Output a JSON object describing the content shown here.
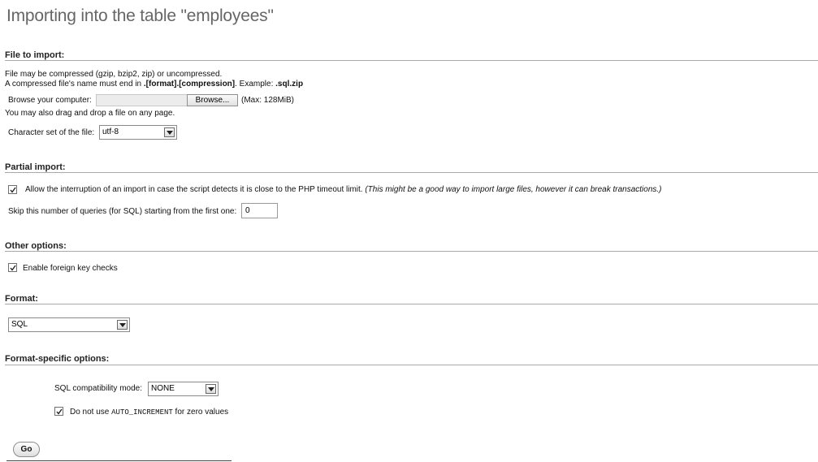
{
  "page": {
    "title": "Importing into the table \"employees\""
  },
  "file_section": {
    "title": "File to import:",
    "desc_line1": "File may be compressed (gzip, bzip2, zip) or uncompressed.",
    "desc_line2_prefix": "A compressed file's name must end in ",
    "desc_line2_format": ".[format].[compression]",
    "desc_line2_mid": ". Example: ",
    "desc_line2_example": ".sql.zip",
    "browse_label": "Browse your computer:",
    "browse_button": "Browse...",
    "max_size": "(Max: 128MiB)",
    "drag_drop_note": "You may also drag and drop a file on any page.",
    "charset_label": "Character set of the file:",
    "charset_value": "utf-8"
  },
  "partial_section": {
    "title": "Partial import:",
    "allow_interrupt_checked": true,
    "allow_interrupt_label": "Allow the interruption of an import in case the script detects it is close to the PHP timeout limit.",
    "allow_interrupt_note": "(This might be a good way to import large files, however it can break transactions.)",
    "skip_label": "Skip this number of queries (for SQL) starting from the first one:",
    "skip_value": "0"
  },
  "other_section": {
    "title": "Other options:",
    "fk_checked": true,
    "fk_label": "Enable foreign key checks"
  },
  "format_section": {
    "title": "Format:",
    "format_value": "SQL"
  },
  "format_specific_section": {
    "title": "Format-specific options:",
    "compat_label": "SQL compatibility mode:",
    "compat_value": "NONE",
    "auto_inc_checked": true,
    "auto_inc_prefix": "Do not use ",
    "auto_inc_code": "AUTO_INCREMENT",
    "auto_inc_suffix": " for zero values"
  },
  "actions": {
    "go_label": "Go"
  },
  "icons": {
    "checkmark": "checkmark-icon",
    "dropdown": "chevron-down-icon"
  }
}
